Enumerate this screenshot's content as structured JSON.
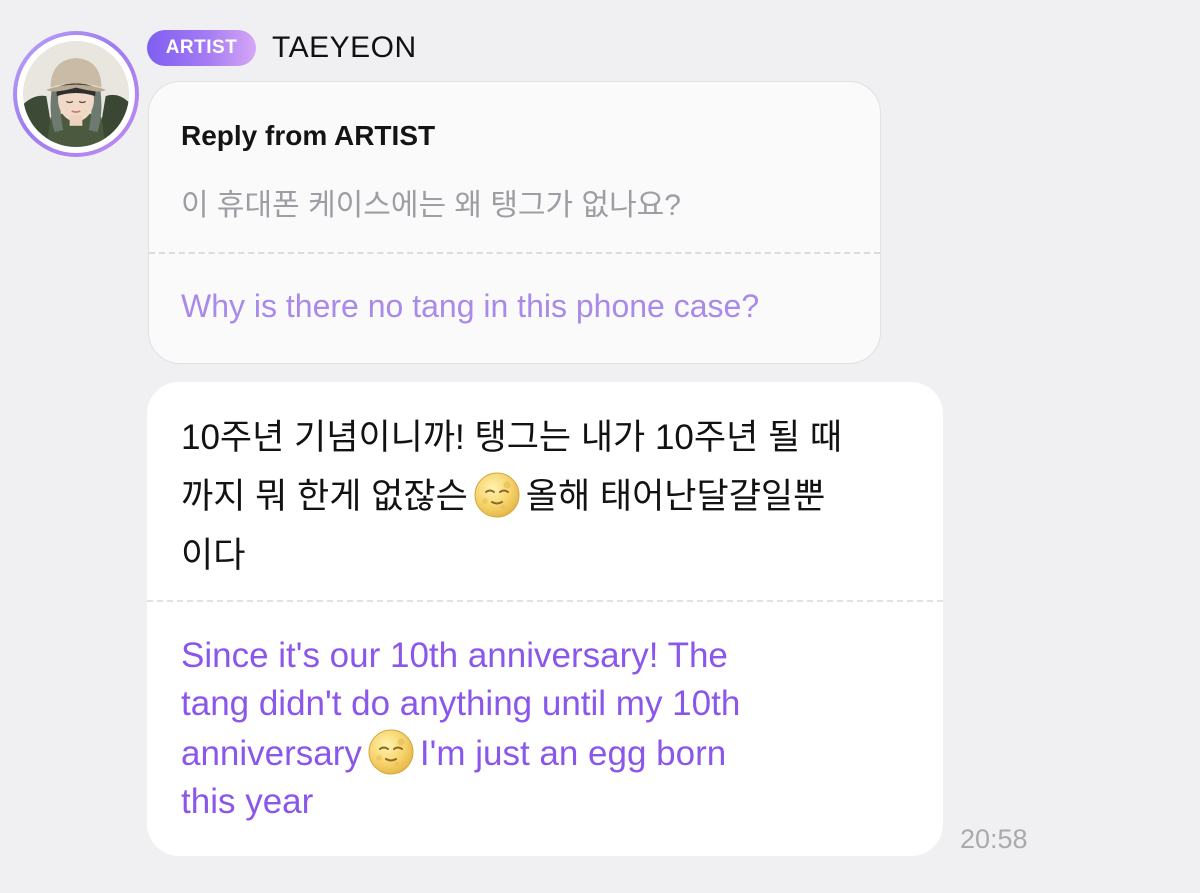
{
  "author": {
    "badge": "ARTIST",
    "name": "TAEYEON"
  },
  "reply": {
    "title": "Reply from ARTIST",
    "original_ko": "이 휴대폰 케이스에는 왜 탱그가 없나요?",
    "translation_en": "Why is there no tang in this phone case?"
  },
  "message": {
    "ko_lines": {
      "l1": "10주년 기념이니까! 탱그는 내가 10주년 될 때",
      "l2a": "까지 뭐 한게 없잖슨",
      "l2b": "올해 태어난달걀일뿐",
      "l3": "이다"
    },
    "en_lines": {
      "l1": "Since it's our 10th anniversary! The",
      "l2": "tang didn't do anything until my 10th",
      "l3a": "anniversary",
      "l3b": "I'm just an egg born",
      "l4": "this year"
    },
    "emoji": "full-moon-face-icon"
  },
  "time": "20:58",
  "colors": {
    "background": "#f0f0f2",
    "badge_gradient_start": "#7f5ef2",
    "badge_gradient_end": "#d6a6f6",
    "translation_purple": "#8b57ea",
    "reply_translation_purple": "#a98ae8",
    "muted_gray": "#9d9da3"
  }
}
